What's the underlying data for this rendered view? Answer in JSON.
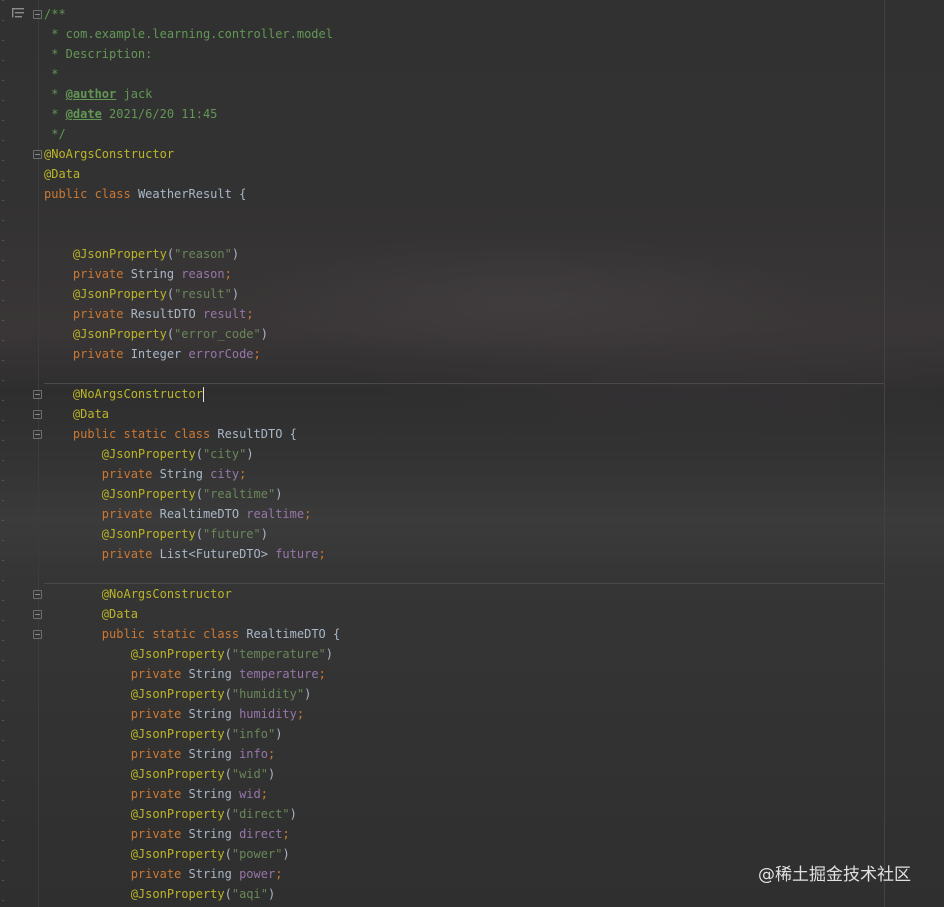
{
  "editor": {
    "lines": [
      [
        {
          "t": "/**",
          "c": "comment"
        }
      ],
      [
        {
          "t": " * com.example.learning.controller.model",
          "c": "comment"
        }
      ],
      [
        {
          "t": " * Description:",
          "c": "comment"
        }
      ],
      [
        {
          "t": " *",
          "c": "comment"
        }
      ],
      [
        {
          "t": " * ",
          "c": "comment"
        },
        {
          "t": "@author",
          "c": "tag"
        },
        {
          "t": " jack",
          "c": "comment"
        }
      ],
      [
        {
          "t": " * ",
          "c": "comment"
        },
        {
          "t": "@date",
          "c": "tag"
        },
        {
          "t": " 2021/6/20 11:45",
          "c": "comment"
        }
      ],
      [
        {
          "t": " */",
          "c": "comment"
        }
      ],
      [
        {
          "t": "@NoArgsConstructor",
          "c": "ann"
        }
      ],
      [
        {
          "t": "@Data",
          "c": "ann"
        }
      ],
      [
        {
          "t": "public ",
          "c": "kw"
        },
        {
          "t": "class ",
          "c": "kw"
        },
        {
          "t": "WeatherResult {",
          "c": "type"
        }
      ],
      [],
      [],
      [
        {
          "t": "    @JsonProperty",
          "c": "ann"
        },
        {
          "t": "(",
          "c": "punct"
        },
        {
          "t": "\"reason\"",
          "c": "str"
        },
        {
          "t": ")",
          "c": "punct"
        }
      ],
      [
        {
          "t": "    private ",
          "c": "kw"
        },
        {
          "t": "String ",
          "c": "type"
        },
        {
          "t": "reason",
          "c": "field"
        },
        {
          "t": ";",
          "c": "kw"
        }
      ],
      [
        {
          "t": "    @JsonProperty",
          "c": "ann"
        },
        {
          "t": "(",
          "c": "punct"
        },
        {
          "t": "\"result\"",
          "c": "str"
        },
        {
          "t": ")",
          "c": "punct"
        }
      ],
      [
        {
          "t": "    private ",
          "c": "kw"
        },
        {
          "t": "ResultDTO ",
          "c": "type"
        },
        {
          "t": "result",
          "c": "field"
        },
        {
          "t": ";",
          "c": "kw"
        }
      ],
      [
        {
          "t": "    @JsonProperty",
          "c": "ann"
        },
        {
          "t": "(",
          "c": "punct"
        },
        {
          "t": "\"error_code\"",
          "c": "str"
        },
        {
          "t": ")",
          "c": "punct"
        }
      ],
      [
        {
          "t": "    private ",
          "c": "kw"
        },
        {
          "t": "Integer ",
          "c": "type"
        },
        {
          "t": "errorCode",
          "c": "field"
        },
        {
          "t": ";",
          "c": "kw"
        }
      ],
      [],
      [
        {
          "t": "    @NoArgsConstructor",
          "c": "ann"
        }
      ],
      [
        {
          "t": "    @Data",
          "c": "ann"
        }
      ],
      [
        {
          "t": "    public ",
          "c": "kw"
        },
        {
          "t": "static ",
          "c": "kw"
        },
        {
          "t": "class ",
          "c": "kw"
        },
        {
          "t": "ResultDTO {",
          "c": "type"
        }
      ],
      [
        {
          "t": "        @JsonProperty",
          "c": "ann"
        },
        {
          "t": "(",
          "c": "punct"
        },
        {
          "t": "\"city\"",
          "c": "str"
        },
        {
          "t": ")",
          "c": "punct"
        }
      ],
      [
        {
          "t": "        private ",
          "c": "kw"
        },
        {
          "t": "String ",
          "c": "type"
        },
        {
          "t": "city",
          "c": "field"
        },
        {
          "t": ";",
          "c": "kw"
        }
      ],
      [
        {
          "t": "        @JsonProperty",
          "c": "ann"
        },
        {
          "t": "(",
          "c": "punct"
        },
        {
          "t": "\"realtime\"",
          "c": "str"
        },
        {
          "t": ")",
          "c": "punct"
        }
      ],
      [
        {
          "t": "        private ",
          "c": "kw"
        },
        {
          "t": "RealtimeDTO ",
          "c": "type"
        },
        {
          "t": "realtime",
          "c": "field"
        },
        {
          "t": ";",
          "c": "kw"
        }
      ],
      [
        {
          "t": "        @JsonProperty",
          "c": "ann"
        },
        {
          "t": "(",
          "c": "punct"
        },
        {
          "t": "\"future\"",
          "c": "str"
        },
        {
          "t": ")",
          "c": "punct"
        }
      ],
      [
        {
          "t": "        private ",
          "c": "kw"
        },
        {
          "t": "List<FutureDTO> ",
          "c": "type"
        },
        {
          "t": "future",
          "c": "field"
        },
        {
          "t": ";",
          "c": "kw"
        }
      ],
      [],
      [
        {
          "t": "        @NoArgsConstructor",
          "c": "ann"
        }
      ],
      [
        {
          "t": "        @Data",
          "c": "ann"
        }
      ],
      [
        {
          "t": "        public ",
          "c": "kw"
        },
        {
          "t": "static ",
          "c": "kw"
        },
        {
          "t": "class ",
          "c": "kw"
        },
        {
          "t": "RealtimeDTO {",
          "c": "type"
        }
      ],
      [
        {
          "t": "            @JsonProperty",
          "c": "ann"
        },
        {
          "t": "(",
          "c": "punct"
        },
        {
          "t": "\"temperature\"",
          "c": "str"
        },
        {
          "t": ")",
          "c": "punct"
        }
      ],
      [
        {
          "t": "            private ",
          "c": "kw"
        },
        {
          "t": "String ",
          "c": "type"
        },
        {
          "t": "temperature",
          "c": "field"
        },
        {
          "t": ";",
          "c": "kw"
        }
      ],
      [
        {
          "t": "            @JsonProperty",
          "c": "ann"
        },
        {
          "t": "(",
          "c": "punct"
        },
        {
          "t": "\"humidity\"",
          "c": "str"
        },
        {
          "t": ")",
          "c": "punct"
        }
      ],
      [
        {
          "t": "            private ",
          "c": "kw"
        },
        {
          "t": "String ",
          "c": "type"
        },
        {
          "t": "humidity",
          "c": "field"
        },
        {
          "t": ";",
          "c": "kw"
        }
      ],
      [
        {
          "t": "            @JsonProperty",
          "c": "ann"
        },
        {
          "t": "(",
          "c": "punct"
        },
        {
          "t": "\"info\"",
          "c": "str"
        },
        {
          "t": ")",
          "c": "punct"
        }
      ],
      [
        {
          "t": "            private ",
          "c": "kw"
        },
        {
          "t": "String ",
          "c": "type"
        },
        {
          "t": "info",
          "c": "field"
        },
        {
          "t": ";",
          "c": "kw"
        }
      ],
      [
        {
          "t": "            @JsonProperty",
          "c": "ann"
        },
        {
          "t": "(",
          "c": "punct"
        },
        {
          "t": "\"wid\"",
          "c": "str"
        },
        {
          "t": ")",
          "c": "punct"
        }
      ],
      [
        {
          "t": "            private ",
          "c": "kw"
        },
        {
          "t": "String ",
          "c": "type"
        },
        {
          "t": "wid",
          "c": "field"
        },
        {
          "t": ";",
          "c": "kw"
        }
      ],
      [
        {
          "t": "            @JsonProperty",
          "c": "ann"
        },
        {
          "t": "(",
          "c": "punct"
        },
        {
          "t": "\"direct\"",
          "c": "str"
        },
        {
          "t": ")",
          "c": "punct"
        }
      ],
      [
        {
          "t": "            private ",
          "c": "kw"
        },
        {
          "t": "String ",
          "c": "type"
        },
        {
          "t": "direct",
          "c": "field"
        },
        {
          "t": ";",
          "c": "kw"
        }
      ],
      [
        {
          "t": "            @JsonProperty",
          "c": "ann"
        },
        {
          "t": "(",
          "c": "punct"
        },
        {
          "t": "\"power\"",
          "c": "str"
        },
        {
          "t": ")",
          "c": "punct"
        }
      ],
      [
        {
          "t": "            private ",
          "c": "kw"
        },
        {
          "t": "String ",
          "c": "type"
        },
        {
          "t": "power",
          "c": "field"
        },
        {
          "t": ";",
          "c": "kw"
        }
      ],
      [
        {
          "t": "            @JsonProperty",
          "c": "ann"
        },
        {
          "t": "(",
          "c": "punct"
        },
        {
          "t": "\"aqi\"",
          "c": "str"
        },
        {
          "t": ")",
          "c": "punct"
        }
      ]
    ],
    "caret_line": 19,
    "fold_lines": [
      0,
      7,
      19,
      20,
      21,
      29,
      30,
      31
    ],
    "separator_after_lines": [
      18,
      28
    ]
  },
  "gutter": {
    "icon": "structure-icon"
  },
  "watermark": {
    "text": "@稀土掘金技术社区"
  },
  "colors": {
    "comment": "#629755",
    "annotation": "#bbb529",
    "keyword": "#cc7832",
    "string": "#6a8759",
    "field": "#9876aa",
    "text": "#a9b7c6"
  }
}
